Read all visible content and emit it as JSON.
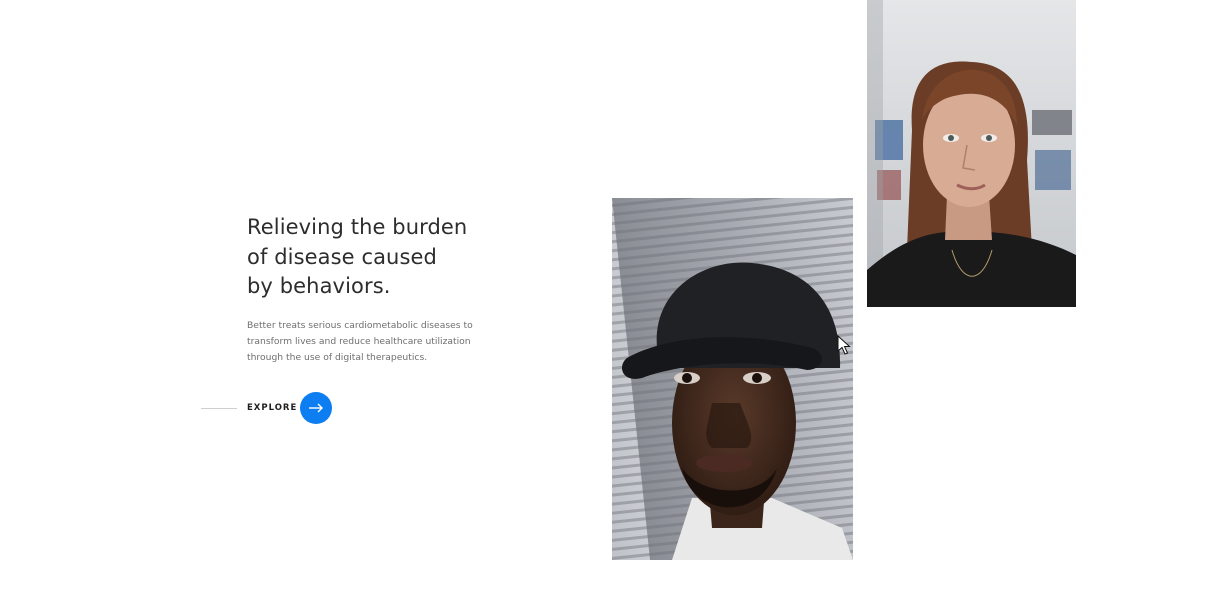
{
  "hero": {
    "headline_lines": [
      "Relieving the burden",
      "of disease caused",
      "by behaviors."
    ],
    "description_lines": [
      "Better treats serious cardiometabolic diseases to",
      "transform lives and reduce healthcare utilization",
      "through the use of digital therapeutics."
    ],
    "cta": {
      "label": "EXPLORE",
      "icon": "arrow-right-icon",
      "color": "#0d7ef2"
    }
  },
  "gallery": {
    "images": [
      {
        "name": "portrait-man-cap"
      },
      {
        "name": "portrait-woman"
      }
    ]
  },
  "colors": {
    "accent": "#0d7ef2",
    "heading": "#2d2d2d",
    "body_text": "#6f6f6f"
  }
}
